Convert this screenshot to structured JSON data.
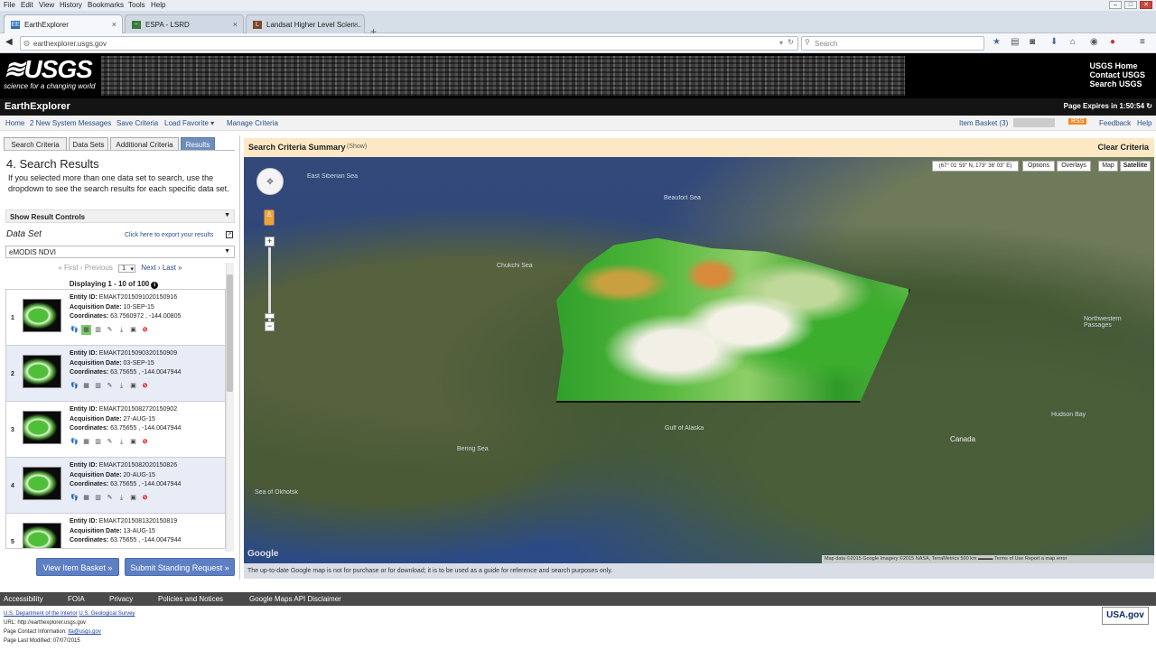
{
  "browser": {
    "menu": [
      "File",
      "Edit",
      "View",
      "History",
      "Bookmarks",
      "Tools",
      "Help"
    ],
    "tabs": [
      {
        "label": "EarthExplorer",
        "fav": "EE"
      },
      {
        "label": "ESPA - LSRD",
        "fav": "~"
      },
      {
        "label": "Landsat Higher Level Scien...",
        "fav": "L"
      }
    ],
    "url": "earthexplorer.usgs.gov",
    "search_placeholder": "Search"
  },
  "usgs": {
    "logo": "USGS",
    "tagline": "science for a changing world",
    "links": [
      "USGS Home",
      "Contact USGS",
      "Search USGS"
    ]
  },
  "app": {
    "title": "EarthExplorer",
    "expires": "Page Expires in 1:50:54"
  },
  "menu": {
    "home": "Home",
    "messages": "2 New System Messages",
    "save": "Save Criteria",
    "load": "Load Favorite",
    "manage": "Manage Criteria",
    "basket": "Item Basket (3)",
    "rss": "RSS",
    "feedback": "Feedback",
    "help": "Help"
  },
  "left": {
    "tabs": [
      "Search Criteria",
      "Data Sets",
      "Additional Criteria",
      "Results"
    ],
    "title": "4. Search Results",
    "desc": "If you selected more than one data set to search, use the dropdown to see the search results for each specific data set.",
    "result_controls": "Show Result Controls",
    "dataset_label": "Data Set",
    "export": "Click here to export your results",
    "dataset_value": "eMODIS NDVI",
    "pager": {
      "first": "« First",
      "prev": "‹ Previous",
      "page": "1",
      "next": "Next ›",
      "last": "Last »"
    },
    "displaying": "Displaying 1 - 10 of 100",
    "results": [
      {
        "num": "1",
        "entity": "EMAKT2015091020150916",
        "date": "10-SEP-15",
        "coords": "63.7560972 , -144.00805"
      },
      {
        "num": "2",
        "entity": "EMAKT2015090320150909",
        "date": "03-SEP-15",
        "coords": "63.75655 , -144.0047944"
      },
      {
        "num": "3",
        "entity": "EMAKT2015082720150902",
        "date": "27-AUG-15",
        "coords": "63.75655 , -144.0047944"
      },
      {
        "num": "4",
        "entity": "EMAKT2015082020150826",
        "date": "20-AUG-15",
        "coords": "63.75655 , -144.0047944"
      },
      {
        "num": "5",
        "entity": "EMAKT2015081320150819",
        "date": "13-AUG-15",
        "coords": "63.75655 , -144.0047944"
      }
    ],
    "labels": {
      "entity": "Entity ID:",
      "date": "Acquisition Date:",
      "coords": "Coordinates:"
    },
    "view_basket": "View Item Basket »",
    "submit": "Submit Standing Request »"
  },
  "map": {
    "summary_title": "Search Criteria Summary",
    "summary_show": "(Show)",
    "clear": "Clear Criteria",
    "coords": "(67° 01' 59\" N, 173° 36' 03\" E)",
    "buttons": [
      "Options",
      "Overlays",
      "Map",
      "Satellite"
    ],
    "labels": {
      "east_siberian": "East Siberian Sea",
      "beaufort": "Beaufort Sea",
      "chukchi": "Chukchi Sea",
      "bering": "Bering Sea",
      "alaska_gulf": "Gulf of Alaska",
      "okhotsk": "Sea of Okhotsk",
      "canada": "Canada",
      "hudson": "Hudson Bay",
      "northwestern": "Northwestern Passages"
    },
    "google": "Google",
    "attribution": "Map data ©2015 Google Imagery ©2015 NASA, TerraMetrics   500 km ▬▬▬   Terms of Use   Report a map error",
    "disclaimer": "The up-to-date Google map is not for purchase or for download; it is to be used as a guide for reference and search purposes only."
  },
  "footer": {
    "links": [
      "Accessibility",
      "FOIA",
      "Privacy",
      "Policies and Notices",
      "Google Maps API Disclaimer"
    ],
    "doi": "U.S. Department of the Interior",
    "survey": "U.S. Geological Survey",
    "url": "URL: http://earthexplorer.usgs.gov",
    "contact_label": "Page Contact Information:",
    "contact": "lta@usgs.gov",
    "modified": "Page Last Modified: 07/07/2015",
    "usagov": "USA.gov"
  }
}
